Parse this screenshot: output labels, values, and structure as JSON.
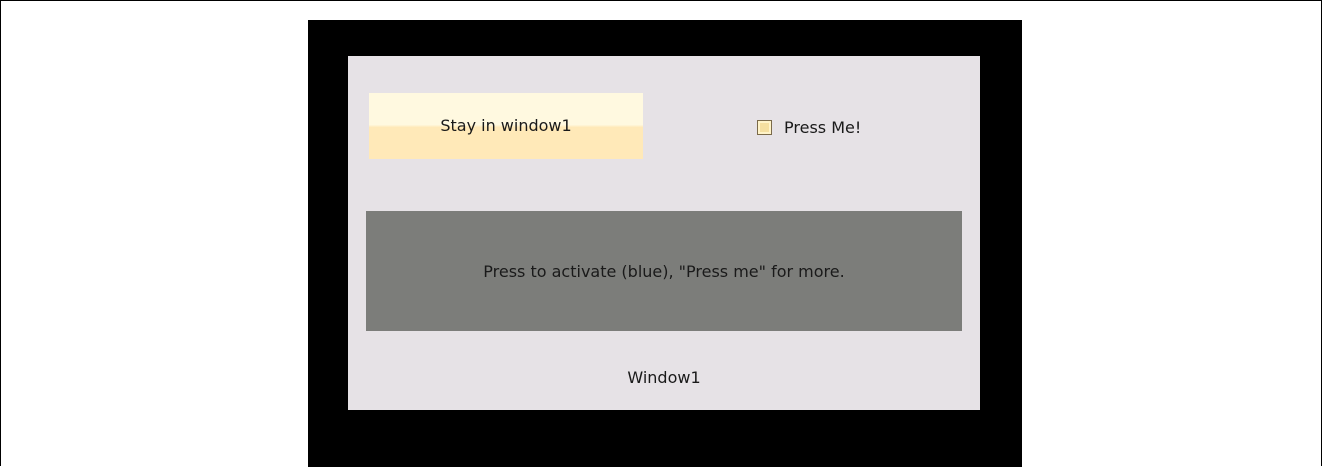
{
  "window": {
    "title": "Window1",
    "stay_button_label": "Stay in window1",
    "press_me_label": "Press Me!",
    "info_text": "Press to activate (blue), \"Press me\" for more."
  },
  "colors": {
    "background": "#ffffff",
    "outer_panel": "#000000",
    "window_bg": "#e6e2e6",
    "button_top": "#fff9e0",
    "button_bottom": "#ffe9b8",
    "info_bar": "#7c7d7a",
    "checkbox_fill": "#f5dfa0"
  },
  "icons": {
    "checkbox": "checkbox-unchecked-icon"
  }
}
